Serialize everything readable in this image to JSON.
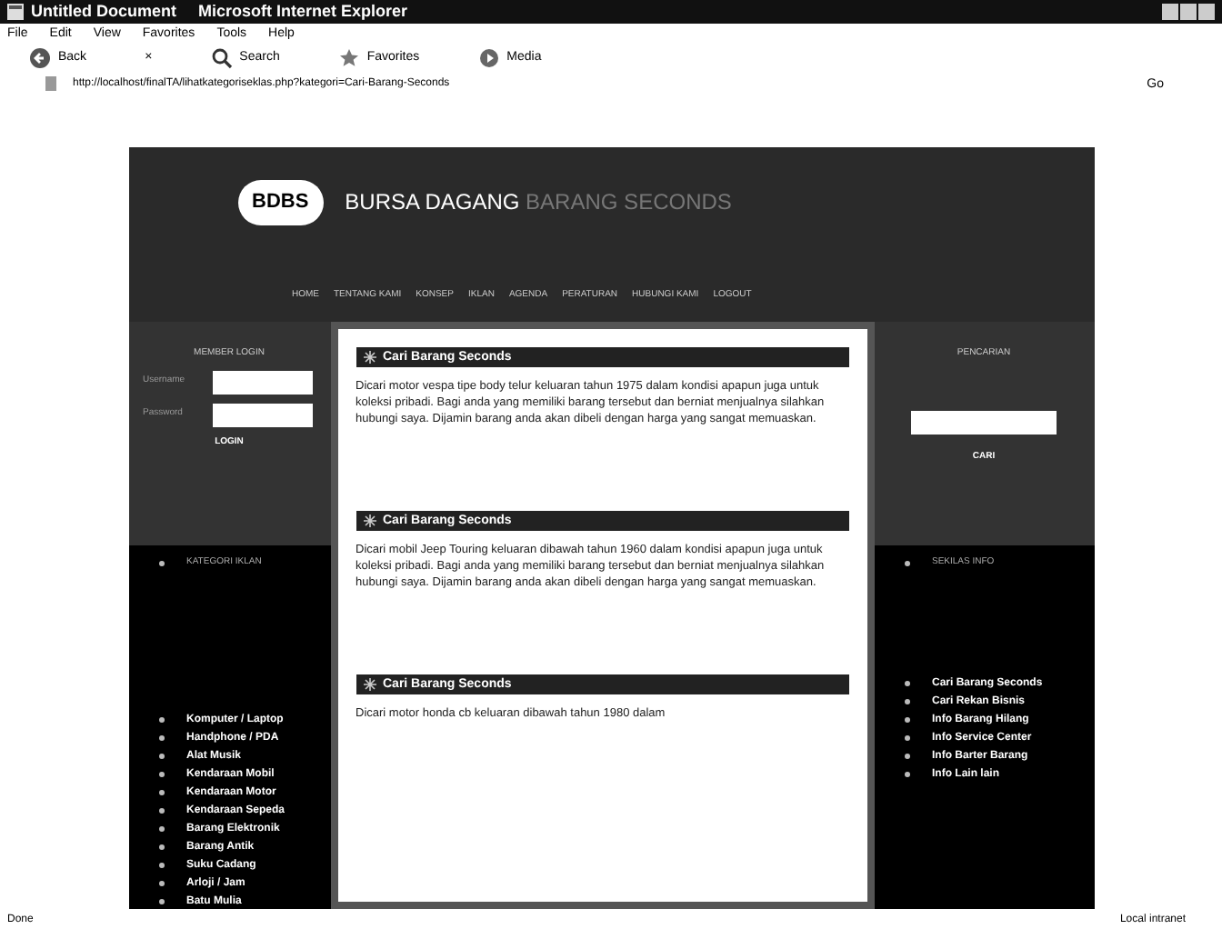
{
  "window": {
    "title": "Untitled Document",
    "app": "Microsoft Internet Explorer"
  },
  "menu": [
    "File",
    "Edit",
    "View",
    "Favorites",
    "Tools",
    "Help"
  ],
  "toolbar": [
    {
      "kind": "back",
      "label": "Back"
    },
    {
      "kind": "stop",
      "label": "×"
    },
    {
      "kind": "search",
      "label": "Search"
    },
    {
      "kind": "favorites",
      "label": "Favorites"
    },
    {
      "kind": "media",
      "label": "Media"
    }
  ],
  "address": {
    "url": "http://localhost/finalTA/lihatkategoriseklas.php?kategori=Cari-Barang-Seconds",
    "go": "Go"
  },
  "header": {
    "logo": "BDBS",
    "title": "BURSA DAGANG",
    "title_faint": "BARANG SECONDS",
    "nav": [
      "HOME",
      "TENTANG KAMI",
      "KONSEP",
      "IKLAN",
      "AGENDA",
      "PERATURAN",
      "HUBUNGI KAMI",
      "LOGOUT"
    ]
  },
  "left": {
    "login_title": "MEMBER LOGIN",
    "fields": [
      "Username",
      "Password"
    ],
    "login_button": "LOGIN",
    "categories_title": "KATEGORI IKLAN",
    "categories": [
      "Komputer / Laptop",
      "Handphone / PDA",
      "Alat Musik",
      "Kendaraan Mobil",
      "Kendaraan Motor",
      "Kendaraan Sepeda",
      "Barang Elektronik",
      "Barang Antik",
      "Suku Cadang",
      "Arloji / Jam",
      "Batu Mulia"
    ]
  },
  "posts": [
    {
      "heading": "Cari Barang Seconds",
      "text": "Dicari motor vespa tipe body telur keluaran tahun 1975 dalam kondisi apapun juga untuk koleksi pribadi. Bagi anda yang memiliki barang tersebut dan berniat menjualnya silahkan hubungi saya. Dijamin barang anda akan dibeli dengan harga yang sangat memuaskan."
    },
    {
      "heading": "Cari Barang Seconds",
      "text": "Dicari mobil Jeep Touring keluaran dibawah tahun 1960 dalam kondisi apapun juga untuk koleksi pribadi. Bagi anda yang memiliki barang tersebut dan berniat menjualnya silahkan hubungi saya. Dijamin barang anda akan dibeli dengan harga yang sangat memuaskan."
    },
    {
      "heading": "Cari Barang Seconds",
      "text": "Dicari motor honda cb keluaran dibawah tahun 1980 dalam"
    }
  ],
  "right": {
    "search_title": "PENCARIAN",
    "search_button": "CARI",
    "info_title": "SEKILAS INFO",
    "links": [
      "Cari Barang Seconds",
      "Cari Rekan Bisnis",
      "Info Barang Hilang",
      "Info Service Center",
      "Info Barter Barang",
      "Info Lain lain"
    ]
  },
  "status": {
    "text": "Done",
    "zone": "Local intranet"
  }
}
